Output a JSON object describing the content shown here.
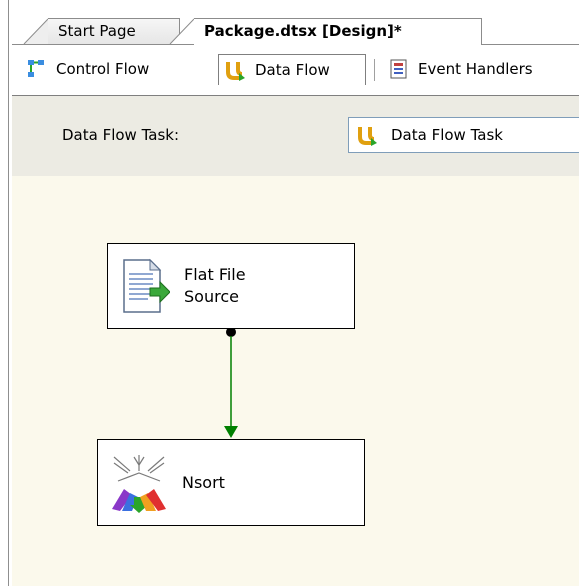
{
  "document_tabs": [
    {
      "label": "Start Page",
      "active": false
    },
    {
      "label": "Package.dtsx [Design]*",
      "active": true
    }
  ],
  "designer_tabs": [
    {
      "label": "Control Flow",
      "icon": "control-flow-icon",
      "active": false
    },
    {
      "label": "Data Flow",
      "icon": "data-flow-icon",
      "active": true
    },
    {
      "label": "Event Handlers",
      "icon": "event-handlers-icon",
      "active": false
    }
  ],
  "task_selector": {
    "label": "Data Flow Task:",
    "selected": "Data Flow Task",
    "icon": "data-flow-task-icon"
  },
  "components": {
    "flat_file_source": {
      "line1": "Flat File",
      "line2": "Source",
      "icon": "flat-file-source-icon"
    },
    "nsort": {
      "label": "Nsort",
      "icon": "nsort-transform-icon"
    }
  },
  "colors": {
    "surface": "#fbf9ec",
    "strip": "#ecebe3",
    "path_green": "#008000"
  }
}
